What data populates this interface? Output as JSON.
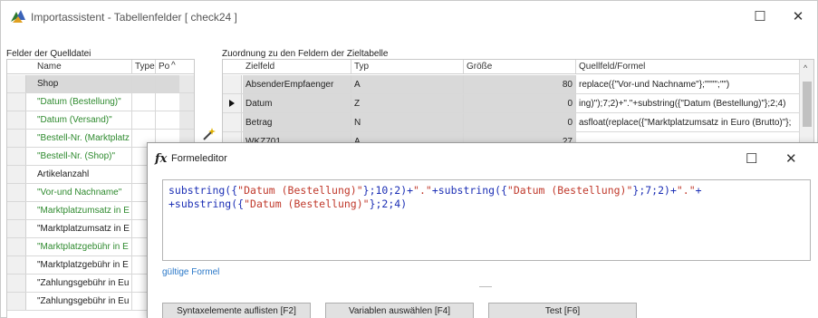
{
  "window": {
    "title": "Importassistent - Tabellenfelder [ check24 ]",
    "maximize_glyph": "☐",
    "close_glyph": "✕"
  },
  "source_panel": {
    "label": "Felder der Quelldatei",
    "columns": [
      "Name",
      "Type",
      "Po"
    ],
    "sort_glyph": "^",
    "rows": [
      {
        "name": "Shop",
        "color": "black",
        "selected": true
      },
      {
        "name": "\"Datum (Bestellung)\"",
        "color": "green",
        "selected": false
      },
      {
        "name": "\"Datum (Versand)\"",
        "color": "green",
        "selected": false
      },
      {
        "name": "\"Bestell-Nr. (Marktplatz",
        "color": "green",
        "selected": false
      },
      {
        "name": "\"Bestell-Nr. (Shop)\"",
        "color": "green",
        "selected": false
      },
      {
        "name": "Artikelanzahl",
        "color": "black",
        "selected": false
      },
      {
        "name": "\"Vor-und Nachname\"",
        "color": "green",
        "selected": false
      },
      {
        "name": "\"Marktplatzumsatz in E",
        "color": "green",
        "selected": false
      },
      {
        "name": "\"Marktplatzumsatz in E",
        "color": "black",
        "selected": false
      },
      {
        "name": "\"Marktplatzgebühr in E",
        "color": "green",
        "selected": false
      },
      {
        "name": "\"Marktplatzgebühr in E",
        "color": "black",
        "selected": false
      },
      {
        "name": "\"Zahlungsgebühr in Eu",
        "color": "black",
        "selected": false
      },
      {
        "name": "\"Zahlungsgebühr in Eu",
        "color": "black",
        "selected": false
      }
    ]
  },
  "target_panel": {
    "label": "Zuordnung zu den Feldern der Zieltabelle",
    "columns": [
      "Zielfeld",
      "Typ",
      "Größe",
      "Quellfeld/Formel"
    ],
    "sort_glyph": "^",
    "rows": [
      {
        "field": "AbsenderEmpfaenger",
        "type": "A",
        "size": "80",
        "formula": "replace({\"Vor-und Nachname\"};\"\"\"\";\"\")",
        "current": false
      },
      {
        "field": "Datum",
        "type": "Z",
        "size": "0",
        "formula": "ing)\");7;2)+\".\"+substring({\"Datum (Bestellung)\"};2;4)",
        "current": true
      },
      {
        "field": "Betrag",
        "type": "N",
        "size": "0",
        "formula": "asfloat(replace({\"Marktplatzumsatz in Euro (Brutto)\"};",
        "current": false
      },
      {
        "field": "WKZ701",
        "type": "A",
        "size": "27",
        "formula": "...",
        "current": false
      }
    ]
  },
  "formula_editor": {
    "title": "Formeleditor",
    "icon": "fx-icon",
    "formula": "substring({\"Datum (Bestellung)\"};10;2)+\".\"+substring({\"Datum (Bestellung)\"};7;2)+\".\"+\n+substring({\"Datum (Bestellung)\"};2;4)",
    "status": "gültige Formel",
    "buttons": {
      "list_syntax": "Syntaxelemente auflisten [F2]",
      "choose_vars": "Variablen auswählen [F4]",
      "test": "Test [F6]"
    }
  },
  "colors": {
    "green_text": "#2e8a2e",
    "formula_text": "#1c2fb5",
    "status_text": "#2a78c8",
    "selected_row": "#d9d9d9"
  }
}
